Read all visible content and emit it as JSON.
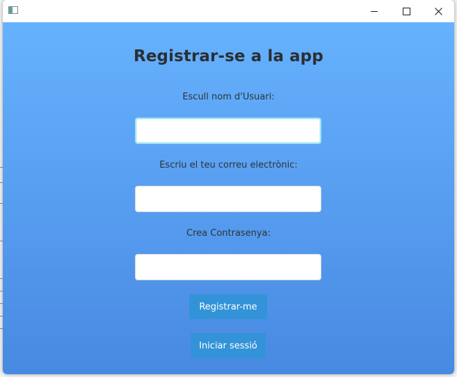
{
  "window": {
    "title": "",
    "icon": "java-app-icon",
    "controls": [
      "minimize-icon",
      "maximize-icon",
      "close-icon"
    ]
  },
  "form": {
    "title": "Registrar-se a la app",
    "username_label": "Escull nom d'Usuari:",
    "username_value": "",
    "email_label": "Escriu el teu correu electrònic:",
    "email_value": "",
    "password_label": "Crea Contrasenya:",
    "password_value": "",
    "register_button": "Registrar-me",
    "login_button": "Iniciar sessió"
  },
  "colors": {
    "gradient_top": "#66b2fe",
    "gradient_bottom": "#4889e2",
    "button": "#3393d8",
    "title_text": "#2b2f33"
  }
}
